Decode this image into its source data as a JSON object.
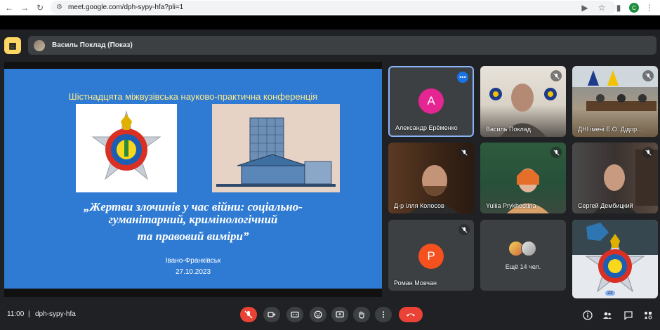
{
  "browser": {
    "url": "meet.google.com/dph-sypy-hfa?pli=1",
    "profile_initial": "C"
  },
  "presenter": {
    "text": "Василь Поклад (Показ)"
  },
  "slide": {
    "title": "Шістнадцята міжвузівська науково-практична конференція",
    "main_line1": "„Жертви злочинів у час війни: соціально-",
    "main_line2": "гуманітарний, кримінологічний",
    "main_line3": "та правовий виміри”",
    "city": "Івано-Франківськ",
    "date": "27.10.2023"
  },
  "tiles": [
    {
      "name": "Александр Ерёменко",
      "initial": "A",
      "color": "#e52592"
    },
    {
      "name": "Василь Поклад"
    },
    {
      "name": "ДНІ імені Е.О. Дідор..."
    },
    {
      "name": "Д-р Ілля Колосов"
    },
    {
      "name": "Yuliia Prykhodtina"
    },
    {
      "name": "Сергей Дембицкий"
    },
    {
      "name": "Роман Мовчан",
      "initial": "P",
      "color": "#f4511e"
    },
    {
      "name": "Ещё 14 чел."
    }
  ],
  "bottom": {
    "time": "11:00",
    "divider": "|",
    "meeting_code": "dph-sypy-hfa",
    "participants_count": "22"
  },
  "colors": {
    "accent": "#8ab4f8",
    "end_call": "#ea4335",
    "slide_bg": "#2f7bd3"
  }
}
